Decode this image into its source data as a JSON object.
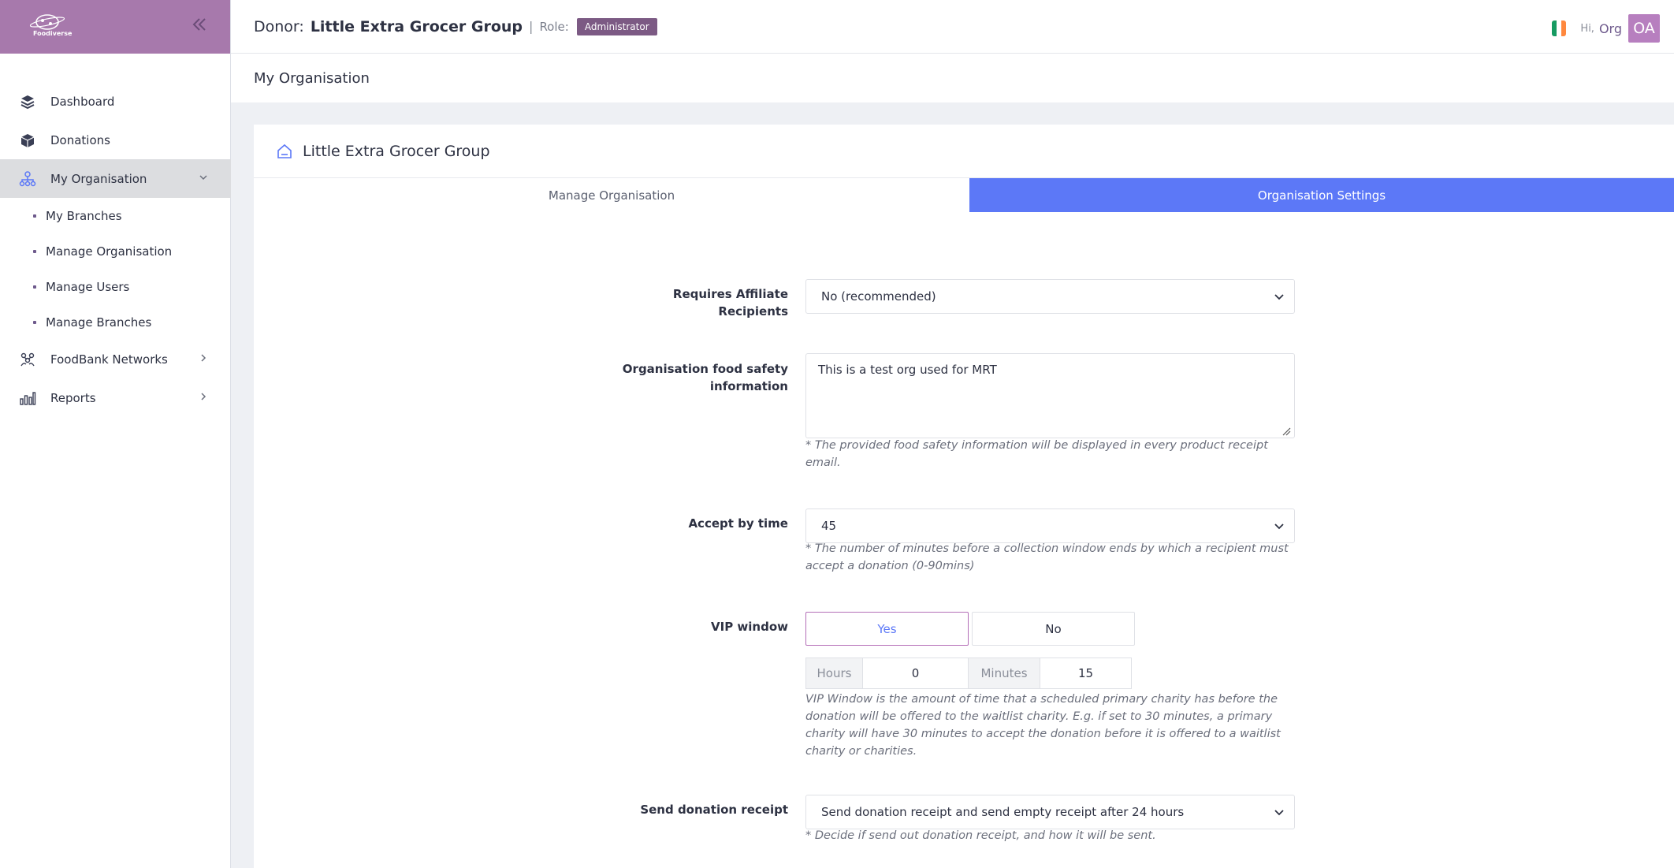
{
  "sidebar": {
    "logo_text": "Foodiverse",
    "items": [
      {
        "label": "Dashboard"
      },
      {
        "label": "Donations"
      },
      {
        "label": "My Organisation"
      },
      {
        "label": "FoodBank Networks"
      },
      {
        "label": "Reports"
      }
    ],
    "sub_items": [
      {
        "label": "My Branches"
      },
      {
        "label": "Manage Organisation"
      },
      {
        "label": "Manage Users"
      },
      {
        "label": "Manage Branches"
      }
    ]
  },
  "header": {
    "donor_label": "Donor:",
    "donor_name": "Little Extra Grocer Group",
    "separator": "|",
    "role_label": "Role:",
    "role_badge": "Administrator",
    "greeting": "Hi,",
    "user_name": "Org",
    "avatar_initials": "OA"
  },
  "page": {
    "title": "My Organisation",
    "card_title": "Little Extra Grocer Group",
    "tabs": [
      {
        "label": "Manage Organisation"
      },
      {
        "label": "Organisation Settings"
      }
    ]
  },
  "form": {
    "affiliate": {
      "label": "Requires Affiliate Recipients",
      "value": "No (recommended)"
    },
    "food_safety": {
      "label": "Organisation food safety information",
      "value": "This is a test org used for MRT",
      "hint": "* The provided food safety information will be displayed in every product receipt email."
    },
    "accept_by": {
      "label": "Accept by time",
      "value": "45",
      "hint": "* The number of minutes before a collection window ends by which a recipient must accept a donation (0-90mins)"
    },
    "vip": {
      "label": "VIP window",
      "yes": "Yes",
      "no": "No",
      "hours_label": "Hours",
      "hours_value": "0",
      "minutes_label": "Minutes",
      "minutes_value": "15",
      "hint": "VIP Window is the amount of time that a scheduled primary charity has before the donation will be offered to the waitlist charity. E.g. if set to 30 minutes, a primary charity will have 30 minutes to accept the donation before it is offered to a waitlist charity or charities."
    },
    "receipt": {
      "label": "Send donation receipt",
      "value": "Send donation receipt and send empty receipt after 24 hours",
      "hint": "* Decide if send out donation receipt, and how it will be sent."
    }
  },
  "colors": {
    "brand": "#a779ac",
    "primary": "#5c78f7",
    "badge": "#7c5a84"
  }
}
